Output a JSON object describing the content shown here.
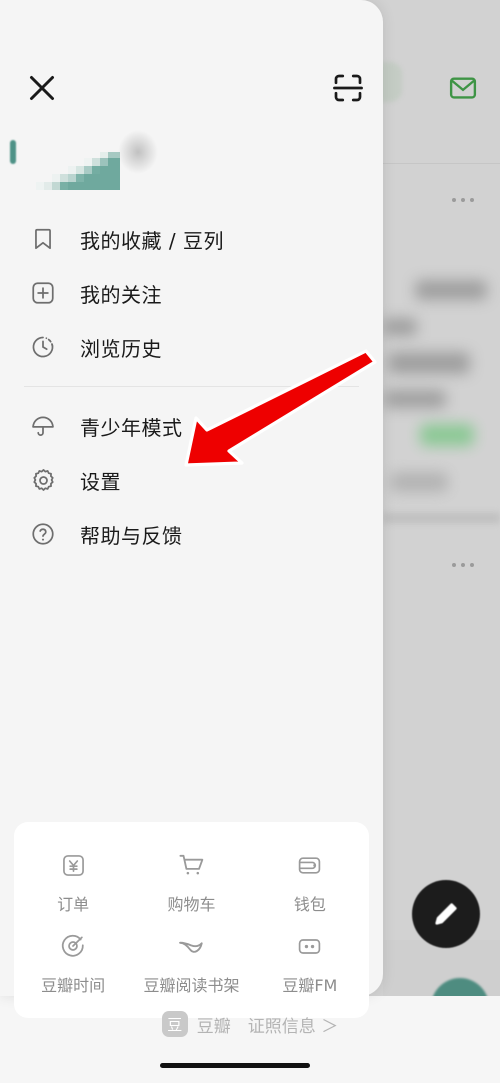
{
  "app": {
    "name": "豆瓣",
    "accent_green": "#3e9445",
    "drawer_bg": "#f5f5f5",
    "card_bg": "#ffffff",
    "annotation_color": "#ee0000"
  },
  "drawer": {
    "close_label": "关闭",
    "close_icon": "close-icon",
    "scan_label": "扫一扫",
    "scan_icon": "scan-icon",
    "profile": {
      "name_redacted": "",
      "avatar_alt": "用户头像"
    },
    "menu": [
      {
        "icon": "bookmark-icon",
        "label": "我的收藏 / 豆列"
      },
      {
        "icon": "plus-square-icon",
        "label": "我的关注"
      },
      {
        "icon": "clock-history-icon",
        "label": "浏览历史"
      },
      {
        "icon": "umbrella-icon",
        "label": "青少年模式"
      },
      {
        "icon": "gear-icon",
        "label": "设置"
      },
      {
        "icon": "question-circle-icon",
        "label": "帮助与反馈"
      }
    ],
    "divider_after_index": 2
  },
  "services_grid": {
    "rows": [
      [
        {
          "icon": "yen-square-icon",
          "label": "订单"
        },
        {
          "icon": "shopping-cart-icon",
          "label": "购物车"
        },
        {
          "icon": "wallet-icon",
          "label": "钱包"
        }
      ],
      [
        {
          "icon": "douban-time-icon",
          "label": "豆瓣时间"
        },
        {
          "icon": "douban-read-icon",
          "label": "豆瓣阅读书架"
        },
        {
          "icon": "douban-fm-icon",
          "label": "豆瓣FM"
        }
      ]
    ]
  },
  "footer": {
    "logo_glyph": "豆",
    "brand": "豆瓣",
    "link_label": "证照信息 ＞"
  },
  "background": {
    "mail_icon": "envelope-icon",
    "more_icon": "ellipsis-icon",
    "compose_icon": "pencil-icon"
  },
  "annotation": {
    "type": "arrow",
    "points_to": "设置",
    "color": "#ee0000"
  }
}
